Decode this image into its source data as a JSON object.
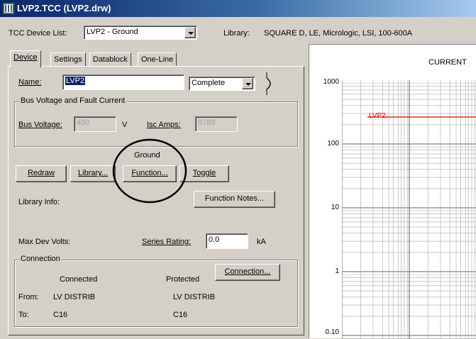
{
  "window": {
    "title": "LVP2.TCC (LVP2.drw)"
  },
  "toolbar": {
    "device_list_label": "TCC Device List:",
    "device_list_value": "LVP2 - Ground",
    "library_label": "Library:",
    "library_value": "SQUARE D, LE, Micrologic, LSI, 100-600A"
  },
  "tabs": [
    "Device",
    "Settings",
    "Datablock",
    "One-Line"
  ],
  "device": {
    "name_label": "Name:",
    "name_value": "LVP2",
    "status_value": "Complete"
  },
  "bus": {
    "group_title": "Bus Voltage and Fault Current",
    "voltage_label": "Bus Voltage:",
    "voltage_value": "480",
    "voltage_unit": "V",
    "isc_label": "Isc Amps:",
    "isc_value": "9789"
  },
  "function_mode": "Ground",
  "buttons": {
    "redraw": "Redraw",
    "library": "Library...",
    "function": "Function...",
    "toggle": "Toggle",
    "function_notes": "Function Notes...",
    "connection": "Connection..."
  },
  "library_info_label": "Library Info:",
  "max_dev_volts_label": "Max Dev Volts:",
  "series_rating": {
    "label": "Series Rating:",
    "value": "0.0",
    "unit": "kA"
  },
  "connection": {
    "group_title": "Connection",
    "connected_header": "Connected",
    "protected_header": "Protected",
    "from_label": "From:",
    "from_connected": "LV DISTRIB",
    "from_protected": "LV DISTRIB",
    "to_label": "To:",
    "to_connected": "C16",
    "to_protected": "C16"
  },
  "plot": {
    "title": "CURRENT",
    "y_ticks": [
      "1000",
      "100",
      "10",
      "1",
      "0.10"
    ],
    "curve_label": "LVP2",
    "curve_color": "#e00000",
    "annotation_color": "#000000"
  }
}
